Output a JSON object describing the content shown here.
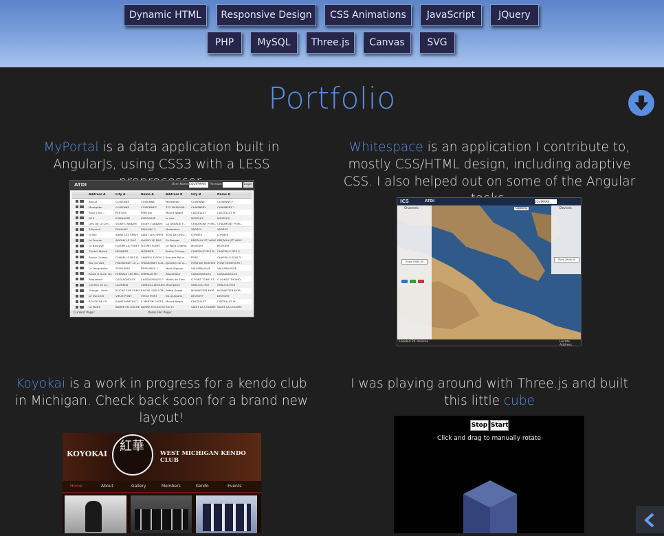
{
  "nav": {
    "row1": [
      "Dynamic HTML",
      "Responsive Design",
      "CSS Animations",
      "JavaScript",
      "JQuery"
    ],
    "row2": [
      "PHP",
      "MySQL",
      "Three.js",
      "Canvas",
      "SVG"
    ]
  },
  "section": {
    "title": "Portfolio"
  },
  "projects": [
    {
      "link": "MyPortal",
      "text": " is a data application built in AngularJs, using CSS3 with a LESS preprocessor."
    },
    {
      "link": "Whitespace",
      "text": " is an application I contribute to, mostly CSS/HTML design, including adaptive CSS. I also helped out on some of the Angular tasks."
    },
    {
      "link": "Koyokai",
      "text": " is a work in progress for a kendo club in Michigan. Check back soon for a brand new layout!"
    },
    {
      "text": "I was playing around with Three.js and built this little ",
      "link": "cube"
    }
  ],
  "screens": {
    "myportal": {
      "brand": "ATDI",
      "user_label": "User Name:",
      "user_value": "EQUIPMAN",
      "pass_label": "Password:",
      "login": "Login",
      "columns": [
        "Address A",
        "City A",
        "Name A",
        "Address B",
        "City B",
        "Name B"
      ],
      "rows": [
        [
          "Bocuit",
          "CUISENNE",
          "CUISENNE",
          "Montgetai",
          "CUISENNE",
          "CUISENNE F"
        ],
        [
          "Montgetai",
          "CUISENNE",
          "CUISENNE F",
          "322 FAUBOUR...",
          "CHAMBERY",
          "CHAMBERY 1"
        ],
        [
          "Roux Croc...",
          "PERTUIS",
          "PERTUIS",
          "Mount Negre",
          "CASTELLET",
          "CASTELLET M"
        ],
        [
          "D13",
          "ESPINASSE",
          "ESPINASSE",
          "la ville",
          "MEXPLES",
          "MEXPLES"
        ],
        [
          "Lieu dit La Cer...",
          "SIGNY L'ABBAYE",
          "SIGNY L'ABBAYE",
          "LA GRANDE F...",
          "CHAUMONT PORC...",
          "CHAUMONT PORC..."
        ],
        [
          "Rillmond",
          "PAULHAC",
          "PAULHAC 2",
          "Malapierre",
          "VARRES",
          "VARRES"
        ],
        [
          "D 983",
          "SAINT LES SPINY",
          "SAINT LES SPINY",
          "BOIS DE ORIG...",
          "LORMES",
          "LORMES"
        ],
        [
          "La Preuve",
          "AVIGNY LE DUC",
          "AVIGNY LE DUC",
          "En Bressel",
          "BREPAUX ET VAUX...",
          "BREPAUX ET VAUX..."
        ],
        [
          "La Boutaye",
          "FLEURY LA FORET",
          "FLEURY FORET",
          "Le Point Champ",
          "MORGNY",
          "MORGNY"
        ],
        [
          "Chateli Mount",
          "MONNIER",
          "MONNIER",
          "Roche Champ...",
          "CHAPELLE DES B...",
          "CHAPELLE DES 3"
        ],
        [
          "Roche Champ...",
          "CHAPELLE DES B...",
          "CHAPELLE BOIS 3",
          "Rue des Palus...",
          "FERE",
          "CHAPELLE BOIS 3"
        ],
        [
          "Roc du Vaix",
          "FRASSEINET LE L...",
          "FRASSEINET LUX...",
          "Quartier de la...",
          "PONT DE MONTVE...",
          "PONT MONTVERT 3"
        ],
        [
          "La Fauqueville",
          "PEYRUISES",
          "PEYRUISES 1",
          "Mont Aigoual",
          "VALLERAUGUE",
          "VALLERAUGUE"
        ],
        [
          "Route D Auch lux",
          "FERRALS LES MO...",
          "FERRALS MT",
          "Roquedaut",
          "CASSAGNOLES",
          "CASSAGNOLES"
        ],
        [
          "Roquebrot",
          "CASSAGNOLES",
          "CASSAGNOLES P",
          "Monts du Som...",
          "G PONT TOME ST...",
          "G PONCE THOMO..."
        ],
        [
          "Chemin de la...",
          "LAURENS",
          "CARDOLLARGUES",
          "Mauripeiro",
          "GRAU DU ROI",
          "GRAU DU ROI"
        ],
        [
          "Grange - Gron...",
          "ROCHE SUR FORON",
          "ROCHE SUR FOR...",
          "Petite Gorge",
          "MONNETIER MOR...",
          "MONNETIER MOR..."
        ],
        [
          "Le Tronchet",
          "VIEUX PONT",
          "VIEUX PONT",
          "les parquets",
          "DEVIGNY",
          "DEVIGNY"
        ],
        [
          "ROUTE DE CE...",
          "SAINT MARTIN D...",
          "S MARTIN CASTIL...",
          "Mount Negre",
          "CASTELLET",
          "CASTELLET M"
        ],
        [
          "La Motte",
          "BARRE EN OUCHE",
          "BARRE EN OUCHE",
          "RD 33",
          "SAINT LA COUDRE",
          "SAINT LA COUDRE"
        ]
      ],
      "footer_left": "Current Page:",
      "footer_right": "Items Per Page:"
    },
    "whitespace": {
      "brand": "ICS",
      "brand_right": "ATDI",
      "user_value": "EQUIPMAN",
      "channels": "Channels",
      "devices": "Devices",
      "options": "Options",
      "status": "Loaded 24 devices",
      "show_hide": "Show /Hide All",
      "locate": "Locate Address"
    },
    "koyokai": {
      "left": "KOYOKAI",
      "mark": "紅華",
      "right": "WEST MICHIGAN KENDO CLUB",
      "menu": [
        "Home",
        "About",
        "Gallery",
        "Members",
        "Kendo",
        "Events"
      ]
    },
    "cube": {
      "stop": "Stop",
      "start": "Start",
      "hint": "Click and drag to manually rotate"
    }
  },
  "colors": {
    "accent": "#5b8de0",
    "header_top": "#5c84c9",
    "header_bottom": "#a8c4ef",
    "background": "#1f1f1f"
  }
}
